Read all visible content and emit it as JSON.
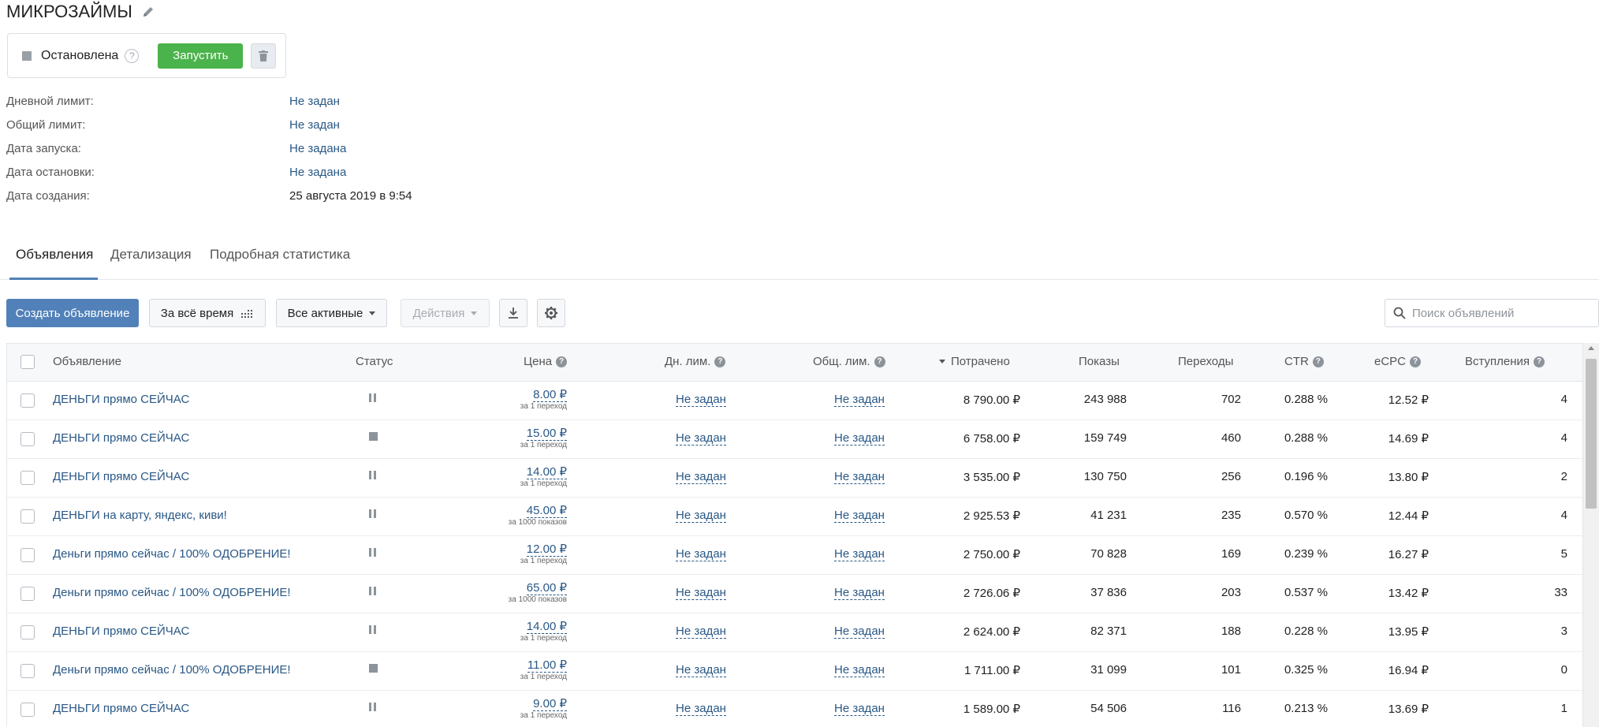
{
  "header": {
    "title": "МИКРОЗАЙМЫ"
  },
  "status": {
    "text": "Остановлена",
    "help": "?",
    "start_button": "Запустить"
  },
  "info": [
    {
      "label": "Дневной лимит:",
      "value": "Не задан"
    },
    {
      "label": "Общий лимит:",
      "value": "Не задан"
    },
    {
      "label": "Дата запуска:",
      "value": "Не задана"
    },
    {
      "label": "Дата остановки:",
      "value": "Не задана"
    },
    {
      "label": "Дата создания:",
      "value": "25 августа 2019 в 9:54"
    }
  ],
  "tabs": [
    "Объявления",
    "Детализация",
    "Подробная статистика"
  ],
  "toolbar": {
    "create": "Создать объявление",
    "period": "За всё время",
    "filter": "Все активные",
    "actions": "Действия",
    "search_placeholder": "Поиск объявлений"
  },
  "table": {
    "headers": {
      "ad": "Объявление",
      "status": "Статус",
      "price": "Цена",
      "day_limit": "Дн. лим.",
      "total_limit": "Общ. лим.",
      "spent": "Потрачено",
      "impressions": "Показы",
      "clicks": "Переходы",
      "ctr": "CTR",
      "ecpc": "eCPC",
      "joins": "Вступления",
      "help": "?"
    },
    "rows": [
      {
        "ad": "ДЕНЬГИ прямо СЕЙЧАС",
        "status": "paused",
        "price": "8.00 ₽",
        "price_sub": "за 1 переход",
        "day_limit": "Не задан",
        "total_limit": "Не задан",
        "spent": "8 790.00 ₽",
        "impressions": "243 988",
        "clicks": "702",
        "ctr": "0.288 %",
        "ecpc": "12.52 ₽",
        "joins": "4"
      },
      {
        "ad": "ДЕНЬГИ прямо СЕЙЧАС",
        "status": "stopped",
        "price": "15.00 ₽",
        "price_sub": "за 1 переход",
        "day_limit": "Не задан",
        "total_limit": "Не задан",
        "spent": "6 758.00 ₽",
        "impressions": "159 749",
        "clicks": "460",
        "ctr": "0.288 %",
        "ecpc": "14.69 ₽",
        "joins": "4"
      },
      {
        "ad": "ДЕНЬГИ прямо СЕЙЧАС",
        "status": "paused",
        "price": "14.00 ₽",
        "price_sub": "за 1 переход",
        "day_limit": "Не задан",
        "total_limit": "Не задан",
        "spent": "3 535.00 ₽",
        "impressions": "130 750",
        "clicks": "256",
        "ctr": "0.196 %",
        "ecpc": "13.80 ₽",
        "joins": "2"
      },
      {
        "ad": "ДЕНЬГИ на карту, яндекс, киви!",
        "status": "paused",
        "price": "45.00 ₽",
        "price_sub": "за 1000 показов",
        "day_limit": "Не задан",
        "total_limit": "Не задан",
        "spent": "2 925.53 ₽",
        "impressions": "41 231",
        "clicks": "235",
        "ctr": "0.570 %",
        "ecpc": "12.44 ₽",
        "joins": "4"
      },
      {
        "ad": "Деньги прямо сейчас / 100% ОДОБРЕНИЕ!",
        "status": "paused",
        "price": "12.00 ₽",
        "price_sub": "за 1 переход",
        "day_limit": "Не задан",
        "total_limit": "Не задан",
        "spent": "2 750.00 ₽",
        "impressions": "70 828",
        "clicks": "169",
        "ctr": "0.239 %",
        "ecpc": "16.27 ₽",
        "joins": "5"
      },
      {
        "ad": "Деньги прямо сейчас / 100% ОДОБРЕНИЕ!",
        "status": "paused",
        "price": "65.00 ₽",
        "price_sub": "за 1000 показов",
        "day_limit": "Не задан",
        "total_limit": "Не задан",
        "spent": "2 726.06 ₽",
        "impressions": "37 836",
        "clicks": "203",
        "ctr": "0.537 %",
        "ecpc": "13.42 ₽",
        "joins": "33"
      },
      {
        "ad": "ДЕНЬГИ прямо СЕЙЧАС",
        "status": "paused",
        "price": "14.00 ₽",
        "price_sub": "за 1 переход",
        "day_limit": "Не задан",
        "total_limit": "Не задан",
        "spent": "2 624.00 ₽",
        "impressions": "82 371",
        "clicks": "188",
        "ctr": "0.228 %",
        "ecpc": "13.95 ₽",
        "joins": "3"
      },
      {
        "ad": "Деньги прямо сейчас / 100% ОДОБРЕНИЕ!",
        "status": "stopped",
        "price": "11.00 ₽",
        "price_sub": "за 1 переход",
        "day_limit": "Не задан",
        "total_limit": "Не задан",
        "spent": "1 711.00 ₽",
        "impressions": "31 099",
        "clicks": "101",
        "ctr": "0.325 %",
        "ecpc": "16.94 ₽",
        "joins": "0"
      },
      {
        "ad": "ДЕНЬГИ прямо СЕЙЧАС",
        "status": "paused",
        "price": "9.00 ₽",
        "price_sub": "за 1 переход",
        "day_limit": "Не задан",
        "total_limit": "Не задан",
        "spent": "1 589.00 ₽",
        "impressions": "54 506",
        "clicks": "116",
        "ctr": "0.213 %",
        "ecpc": "13.69 ₽",
        "joins": "1"
      }
    ]
  },
  "icons": {
    "edit": "pencil-icon",
    "delete": "trash-icon",
    "period": "calendar-grid-icon",
    "download": "download-icon",
    "settings": "gear-icon",
    "search": "search-icon"
  },
  "colors": {
    "accent": "#5181b8",
    "link": "#2a5885",
    "start": "#4bb34b"
  }
}
